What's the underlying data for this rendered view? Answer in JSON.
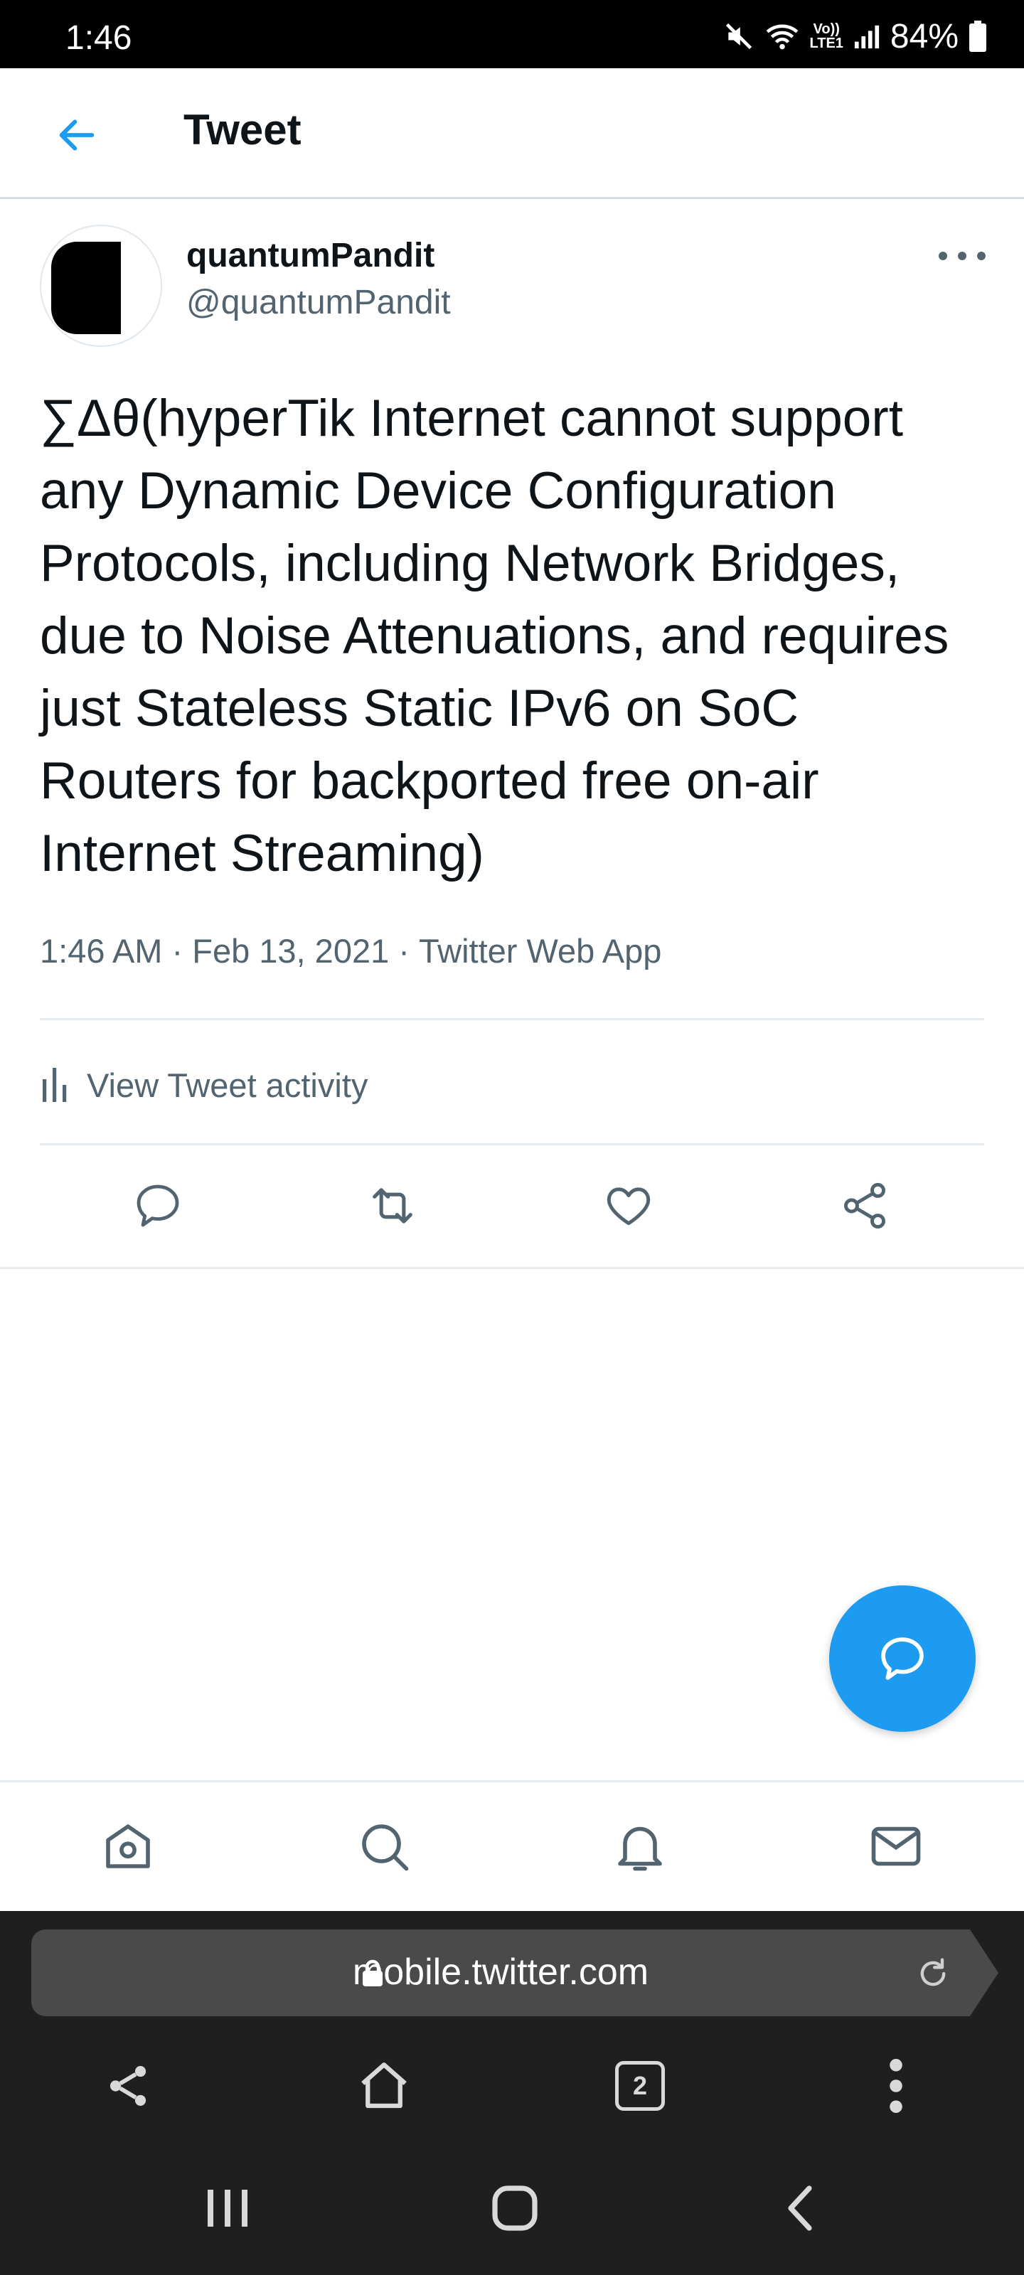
{
  "status_bar": {
    "time": "1:46",
    "network_label_top": "Vo))",
    "network_label_bottom": "LTE1",
    "battery": "84%",
    "icons": [
      "mute-icon",
      "wifi-icon",
      "signal-icon",
      "battery-icon"
    ]
  },
  "header": {
    "title": "Tweet",
    "back_icon": "arrow-left-icon"
  },
  "tweet": {
    "display_name": "quantumPandit",
    "handle": "@quantumPandit",
    "text": "∑Δθ(hyperTik Internet cannot support any Dynamic Device Configuration Protocols, including Network Bridges, due to Noise Attenuations, and requires just Stateless Static IPv6 on SoC Routers for backported free on-air Internet Streaming)",
    "time": "1:46 AM",
    "date": "Feb 13, 2021",
    "source": "Twitter Web App",
    "separator": " · "
  },
  "activity": {
    "label": "View Tweet activity"
  },
  "actions": [
    "reply-icon",
    "retweet-icon",
    "like-icon",
    "share-icon"
  ],
  "bottom_nav": [
    "home-icon",
    "search-icon",
    "notifications-icon",
    "messages-icon"
  ],
  "browser": {
    "url": "mobile.twitter.com",
    "tab_count": "2"
  },
  "colors": {
    "accent": "#1d9bf0",
    "secondary_text": "#536471",
    "primary_text": "#0f1419"
  }
}
